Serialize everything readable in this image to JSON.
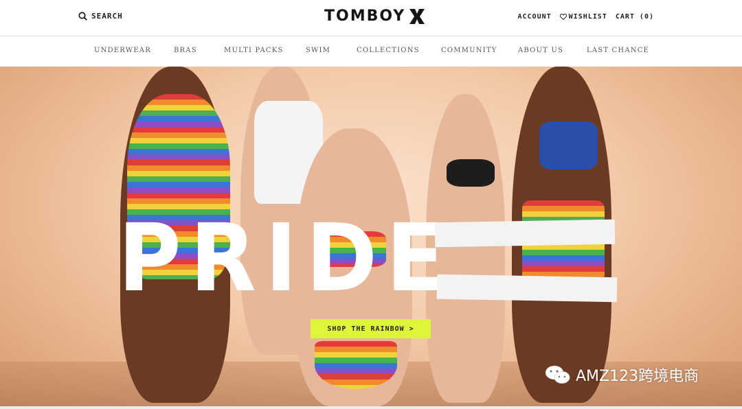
{
  "header": {
    "search_label": "SEARCH",
    "logo_text": "TOMBOY",
    "account_label": "ACCOUNT",
    "wishlist_label": "WISHLIST",
    "cart_label": "CART (0)"
  },
  "nav": {
    "items": [
      "UNDERWEAR",
      "BRAS",
      "MULTI PACKS",
      "SWIM",
      "COLLECTIONS",
      "COMMUNITY",
      "ABOUT US",
      "LAST CHANCE"
    ]
  },
  "hero": {
    "headline": "PRIDE",
    "cta_label": "SHOP THE RAINBOW >"
  },
  "watermark": {
    "text": "AMZ123跨境电商"
  },
  "colors": {
    "cta_background": "#dff53a",
    "text_dark": "#151515",
    "nav_text": "#555555"
  },
  "icons": [
    "search-icon",
    "logo-x-icon",
    "heart-icon",
    "wechat-icon"
  ]
}
